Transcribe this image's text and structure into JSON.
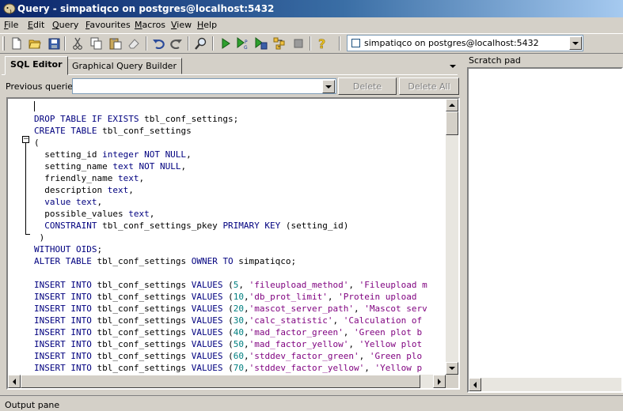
{
  "window": {
    "title": "Query - simpatiqco on postgres@localhost:5432"
  },
  "menu": [
    "File",
    "Edit",
    "Query",
    "Favourites",
    "Macros",
    "View",
    "Help"
  ],
  "toolbar": {
    "icons": [
      "new-file-icon",
      "open-folder-icon",
      "save-icon",
      "cut-icon",
      "copy-icon",
      "paste-icon",
      "clear-icon",
      "undo-icon",
      "redo-icon",
      "find-icon",
      "execute-icon",
      "explain-icon",
      "execute-to-file-icon",
      "explain-analyze-icon",
      "cancel-query-icon",
      "help-icon"
    ]
  },
  "connection": {
    "value": "simpatiqco on postgres@localhost:5432"
  },
  "tabs": [
    {
      "label": "SQL Editor",
      "active": true
    },
    {
      "label": "Graphical Query Builder",
      "active": false
    }
  ],
  "previous_queries": {
    "label": "Previous queries",
    "value": ""
  },
  "buttons": {
    "delete": "Delete",
    "delete_all": "Delete All"
  },
  "editor": {
    "lines": [
      {
        "t": ""
      },
      {
        "parts": [
          {
            "c": "kw",
            "t": "DROP TABLE IF EXISTS"
          },
          {
            "c": "",
            "t": " tbl_conf_settings;"
          }
        ]
      },
      {
        "parts": [
          {
            "c": "kw",
            "t": "CREATE TABLE"
          },
          {
            "c": "",
            "t": " tbl_conf_settings"
          }
        ]
      },
      {
        "parts": [
          {
            "c": "",
            "t": "("
          }
        ]
      },
      {
        "parts": [
          {
            "c": "",
            "t": "  setting_id "
          },
          {
            "c": "kw",
            "t": "integer NOT NULL"
          },
          {
            "c": "",
            "t": ","
          }
        ]
      },
      {
        "parts": [
          {
            "c": "",
            "t": "  setting_name "
          },
          {
            "c": "kw",
            "t": "text NOT NULL"
          },
          {
            "c": "",
            "t": ","
          }
        ]
      },
      {
        "parts": [
          {
            "c": "",
            "t": "  friendly_name "
          },
          {
            "c": "kw",
            "t": "text"
          },
          {
            "c": "",
            "t": ","
          }
        ]
      },
      {
        "parts": [
          {
            "c": "",
            "t": "  description "
          },
          {
            "c": "kw",
            "t": "text"
          },
          {
            "c": "",
            "t": ","
          }
        ]
      },
      {
        "parts": [
          {
            "c": "",
            "t": "  "
          },
          {
            "c": "kw",
            "t": "value text"
          },
          {
            "c": "",
            "t": ","
          }
        ]
      },
      {
        "parts": [
          {
            "c": "",
            "t": "  possible_values "
          },
          {
            "c": "kw",
            "t": "text"
          },
          {
            "c": "",
            "t": ","
          }
        ]
      },
      {
        "parts": [
          {
            "c": "",
            "t": "  "
          },
          {
            "c": "kw",
            "t": "CONSTRAINT"
          },
          {
            "c": "",
            "t": " tbl_conf_settings_pkey "
          },
          {
            "c": "kw",
            "t": "PRIMARY KEY"
          },
          {
            "c": "",
            "t": " (setting_id)"
          }
        ]
      },
      {
        "parts": [
          {
            "c": "",
            "t": " )"
          }
        ]
      },
      {
        "parts": [
          {
            "c": "kw",
            "t": "WITHOUT OIDS"
          },
          {
            "c": "",
            "t": ";"
          }
        ]
      },
      {
        "parts": [
          {
            "c": "kw",
            "t": "ALTER TABLE"
          },
          {
            "c": "",
            "t": " tbl_conf_settings "
          },
          {
            "c": "kw",
            "t": "OWNER TO"
          },
          {
            "c": "",
            "t": " simpatiqco;"
          }
        ]
      },
      {
        "parts": [
          {
            "c": "",
            "t": ""
          }
        ]
      },
      {
        "parts": [
          {
            "c": "kw",
            "t": "INSERT INTO"
          },
          {
            "c": "",
            "t": " tbl_conf_settings "
          },
          {
            "c": "kw",
            "t": "VALUES"
          },
          {
            "c": "",
            "t": " ("
          },
          {
            "c": "num",
            "t": "5"
          },
          {
            "c": "",
            "t": ", "
          },
          {
            "c": "str",
            "t": "'fileupload_method'"
          },
          {
            "c": "",
            "t": ", "
          },
          {
            "c": "str",
            "t": "'Fileupload m"
          }
        ]
      },
      {
        "parts": [
          {
            "c": "kw",
            "t": "INSERT INTO"
          },
          {
            "c": "",
            "t": " tbl_conf_settings "
          },
          {
            "c": "kw",
            "t": "VALUES"
          },
          {
            "c": "",
            "t": " ("
          },
          {
            "c": "num",
            "t": "10"
          },
          {
            "c": "",
            "t": ","
          },
          {
            "c": "str",
            "t": "'db_prot_limit'"
          },
          {
            "c": "",
            "t": ", "
          },
          {
            "c": "str",
            "t": "'Protein upload"
          }
        ]
      },
      {
        "parts": [
          {
            "c": "kw",
            "t": "INSERT INTO"
          },
          {
            "c": "",
            "t": " tbl_conf_settings "
          },
          {
            "c": "kw",
            "t": "VALUES"
          },
          {
            "c": "",
            "t": " ("
          },
          {
            "c": "num",
            "t": "20"
          },
          {
            "c": "",
            "t": ","
          },
          {
            "c": "str",
            "t": "'mascot_server_path'"
          },
          {
            "c": "",
            "t": ", "
          },
          {
            "c": "str",
            "t": "'Mascot serv"
          }
        ]
      },
      {
        "parts": [
          {
            "c": "kw",
            "t": "INSERT INTO"
          },
          {
            "c": "",
            "t": " tbl_conf_settings "
          },
          {
            "c": "kw",
            "t": "VALUES"
          },
          {
            "c": "",
            "t": " ("
          },
          {
            "c": "num",
            "t": "30"
          },
          {
            "c": "",
            "t": ","
          },
          {
            "c": "str",
            "t": "'calc_statistic'"
          },
          {
            "c": "",
            "t": ", "
          },
          {
            "c": "str",
            "t": "'Calculation of"
          }
        ]
      },
      {
        "parts": [
          {
            "c": "kw",
            "t": "INSERT INTO"
          },
          {
            "c": "",
            "t": " tbl_conf_settings "
          },
          {
            "c": "kw",
            "t": "VALUES"
          },
          {
            "c": "",
            "t": " ("
          },
          {
            "c": "num",
            "t": "40"
          },
          {
            "c": "",
            "t": ","
          },
          {
            "c": "str",
            "t": "'mad_factor_green'"
          },
          {
            "c": "",
            "t": ", "
          },
          {
            "c": "str",
            "t": "'Green plot b"
          }
        ]
      },
      {
        "parts": [
          {
            "c": "kw",
            "t": "INSERT INTO"
          },
          {
            "c": "",
            "t": " tbl_conf_settings "
          },
          {
            "c": "kw",
            "t": "VALUES"
          },
          {
            "c": "",
            "t": " ("
          },
          {
            "c": "num",
            "t": "50"
          },
          {
            "c": "",
            "t": ","
          },
          {
            "c": "str",
            "t": "'mad_factor_yellow'"
          },
          {
            "c": "",
            "t": ", "
          },
          {
            "c": "str",
            "t": "'Yellow plot"
          }
        ]
      },
      {
        "parts": [
          {
            "c": "kw",
            "t": "INSERT INTO"
          },
          {
            "c": "",
            "t": " tbl_conf_settings "
          },
          {
            "c": "kw",
            "t": "VALUES"
          },
          {
            "c": "",
            "t": " ("
          },
          {
            "c": "num",
            "t": "60"
          },
          {
            "c": "",
            "t": ","
          },
          {
            "c": "str",
            "t": "'stddev_factor_green'"
          },
          {
            "c": "",
            "t": ", "
          },
          {
            "c": "str",
            "t": "'Green plo"
          }
        ]
      },
      {
        "parts": [
          {
            "c": "kw",
            "t": "INSERT INTO"
          },
          {
            "c": "",
            "t": " tbl_conf_settings "
          },
          {
            "c": "kw",
            "t": "VALUES"
          },
          {
            "c": "",
            "t": " ("
          },
          {
            "c": "num",
            "t": "70"
          },
          {
            "c": "",
            "t": ","
          },
          {
            "c": "str",
            "t": "'stddev_factor_yellow'"
          },
          {
            "c": "",
            "t": ", "
          },
          {
            "c": "str",
            "t": "'Yellow p"
          }
        ]
      }
    ]
  },
  "scratch_pad": {
    "label": "Scratch pad"
  },
  "status": {
    "output_pane": "Output pane"
  },
  "colors": {
    "keyword": "#00007f",
    "string": "#7f007f",
    "number": "#007f7f",
    "titlebar": "#0a246a"
  }
}
